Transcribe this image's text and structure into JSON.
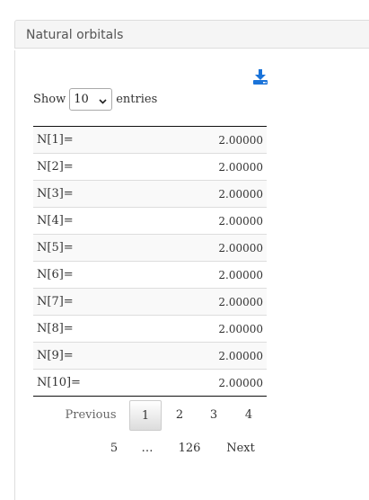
{
  "panel": {
    "title": "Natural orbitals"
  },
  "download": {
    "icon": "download-icon",
    "color": "#1a73d9"
  },
  "length_menu": {
    "prefix": "Show",
    "selected": "10",
    "suffix": "entries"
  },
  "table": {
    "rows": [
      [
        "N[1]=",
        "2.00000"
      ],
      [
        "N[2]=",
        "2.00000"
      ],
      [
        "N[3]=",
        "2.00000"
      ],
      [
        "N[4]=",
        "2.00000"
      ],
      [
        "N[5]=",
        "2.00000"
      ],
      [
        "N[6]=",
        "2.00000"
      ],
      [
        "N[7]=",
        "2.00000"
      ],
      [
        "N[8]=",
        "2.00000"
      ],
      [
        "N[9]=",
        "2.00000"
      ],
      [
        "N[10]=",
        "2.00000"
      ]
    ]
  },
  "pagination": {
    "previous": "Previous",
    "pages": [
      "1",
      "2",
      "3",
      "4",
      "5"
    ],
    "ellipsis": "…",
    "last": "126",
    "next": "Next",
    "current": "1"
  }
}
